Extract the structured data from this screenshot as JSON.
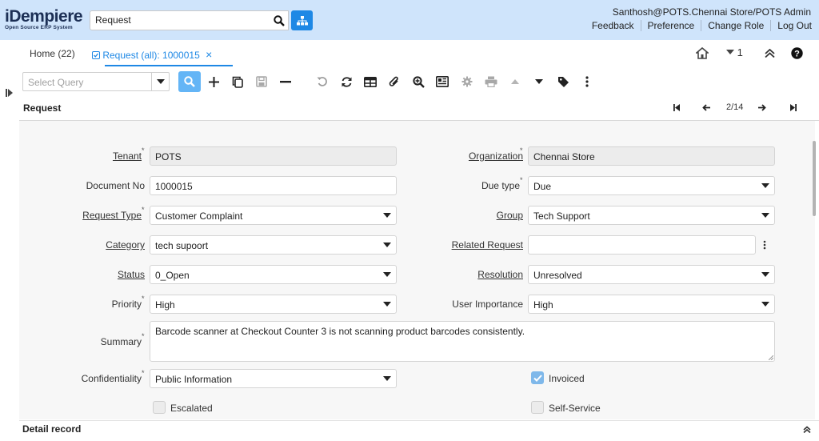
{
  "header": {
    "logo_main": "iDempiere",
    "logo_sub": "Open Source ERP System",
    "search_value": "Request",
    "user": "Santhosh@POTS.Chennai Store/POTS Admin",
    "links": [
      "Feedback",
      "Preference",
      "Change Role",
      "Log Out"
    ]
  },
  "tabs": {
    "home": "Home (22)",
    "active": "Request (all): 1000015",
    "close": "×",
    "window_count": "1"
  },
  "toolbar": {
    "query_placeholder": "Select Query"
  },
  "title": {
    "form": "Request",
    "record_position": "2/14"
  },
  "form": {
    "tenant": {
      "label": "Tenant",
      "value": "POTS"
    },
    "organization": {
      "label": "Organization",
      "value": "Chennai Store"
    },
    "document_no": {
      "label": "Document No",
      "value": "1000015"
    },
    "due_type": {
      "label": "Due type",
      "value": "Due"
    },
    "request_type": {
      "label": "Request Type",
      "value": "Customer Complaint"
    },
    "group": {
      "label": "Group",
      "value": "Tech Support"
    },
    "category": {
      "label": "Category",
      "value": "tech supoort"
    },
    "related_request": {
      "label": "Related Request",
      "value": ""
    },
    "status": {
      "label": "Status",
      "value": "0_Open"
    },
    "resolution": {
      "label": "Resolution",
      "value": "Unresolved"
    },
    "priority": {
      "label": "Priority",
      "value": "High"
    },
    "user_importance": {
      "label": "User Importance",
      "value": "High"
    },
    "summary": {
      "label": "Summary",
      "value": "Barcode scanner at Checkout Counter 3 is not scanning product barcodes consistently."
    },
    "confidentiality": {
      "label": "Confidentiality",
      "value": "Public Information"
    },
    "invoiced": {
      "label": "Invoiced",
      "checked": true
    },
    "escalated": {
      "label": "Escalated",
      "checked": false
    },
    "self_service": {
      "label": "Self-Service",
      "checked": false
    }
  },
  "detail": {
    "title": "Detail record"
  },
  "colors": {
    "accent": "#1e88e5",
    "header_bg": "#cfe4fb"
  },
  "icons": [
    "search-icon",
    "tree-icon",
    "home-icon",
    "chevron-down-icon",
    "collapse-up-icon",
    "help-icon",
    "new-icon",
    "copy-icon",
    "save-icon",
    "delete-icon",
    "undo-icon",
    "refresh-icon",
    "grid-toggle-icon",
    "attachment-icon",
    "zoom-icon",
    "report-icon",
    "process-icon",
    "print-icon",
    "parent-record-icon",
    "detail-record-icon",
    "tag-icon",
    "more-icon",
    "first-record-icon",
    "previous-record-icon",
    "next-record-icon",
    "last-record-icon"
  ]
}
